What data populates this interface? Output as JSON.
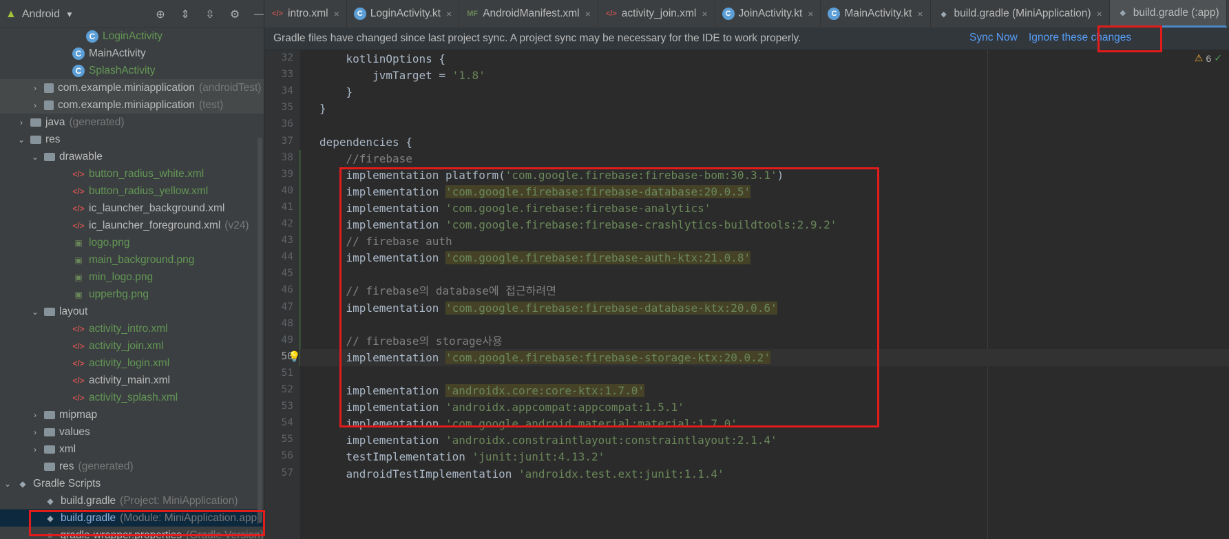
{
  "sidebar": {
    "view_selector": "Android",
    "items": [
      {
        "label": "LoginActivity",
        "icon": "kotlin-class-icon",
        "color": "green",
        "indent": 105
      },
      {
        "label": "MainActivity",
        "icon": "kotlin-class-icon",
        "color": "normal",
        "indent": 85
      },
      {
        "label": "SplashActivity",
        "icon": "kotlin-class-icon",
        "color": "green",
        "indent": 85
      },
      {
        "label": "com.example.miniapplication",
        "suffix": "(androidTest)",
        "icon": "package-icon",
        "arrow": "›",
        "indent": 44,
        "hl": true
      },
      {
        "label": "com.example.miniapplication",
        "suffix": "(test)",
        "icon": "package-icon",
        "arrow": "›",
        "indent": 44,
        "hl": true
      },
      {
        "label": "java",
        "suffix": "(generated)",
        "icon": "folder-icon",
        "arrow": "›",
        "indent": 24
      },
      {
        "label": "res",
        "icon": "folder-icon",
        "arrow": "⌄",
        "indent": 24
      },
      {
        "label": "drawable",
        "icon": "folder-icon",
        "arrow": "⌄",
        "indent": 44
      },
      {
        "label": "button_radius_white.xml",
        "icon": "xml-file-icon",
        "color": "green",
        "indent": 85
      },
      {
        "label": "button_radius_yellow.xml",
        "icon": "xml-file-icon",
        "color": "green",
        "indent": 85
      },
      {
        "label": "ic_launcher_background.xml",
        "icon": "xml-file-icon",
        "indent": 85
      },
      {
        "label": "ic_launcher_foreground.xml",
        "suffix": "(v24)",
        "icon": "xml-file-icon",
        "indent": 85
      },
      {
        "label": "logo.png",
        "icon": "image-file-icon",
        "color": "green",
        "indent": 85
      },
      {
        "label": "main_background.png",
        "icon": "image-file-icon",
        "color": "green",
        "indent": 85
      },
      {
        "label": "min_logo.png",
        "icon": "image-file-icon",
        "color": "green",
        "indent": 85
      },
      {
        "label": "upperbg.png",
        "icon": "image-file-icon",
        "color": "green",
        "indent": 85
      },
      {
        "label": "layout",
        "icon": "folder-icon",
        "arrow": "⌄",
        "indent": 44
      },
      {
        "label": "activity_intro.xml",
        "icon": "xml-file-icon",
        "color": "green",
        "indent": 85
      },
      {
        "label": "activity_join.xml",
        "icon": "xml-file-icon",
        "color": "green",
        "indent": 85
      },
      {
        "label": "activity_login.xml",
        "icon": "xml-file-icon",
        "color": "green",
        "indent": 85
      },
      {
        "label": "activity_main.xml",
        "icon": "xml-file-icon",
        "indent": 85
      },
      {
        "label": "activity_splash.xml",
        "icon": "xml-file-icon",
        "color": "green",
        "indent": 85
      },
      {
        "label": "mipmap",
        "icon": "folder-icon",
        "arrow": "›",
        "indent": 44
      },
      {
        "label": "values",
        "icon": "folder-icon",
        "arrow": "›",
        "indent": 44
      },
      {
        "label": "xml",
        "icon": "folder-icon",
        "arrow": "›",
        "indent": 44
      },
      {
        "label": "res",
        "suffix": "(generated)",
        "icon": "folder-icon",
        "indent": 44
      },
      {
        "label": "Gradle Scripts",
        "icon": "gradle-icon",
        "arrow": "⌄",
        "indent": 4
      },
      {
        "label": "build.gradle",
        "suffix": "(Project: MiniApplication)",
        "icon": "gradle-icon",
        "indent": 44
      },
      {
        "label": "build.gradle",
        "suffix": "(Module: MiniApplication.app)",
        "icon": "gradle-icon",
        "color": "blue",
        "indent": 44,
        "sel": true
      },
      {
        "label": "gradle-wrapper.properties",
        "suffix": "(Gradle Version)",
        "icon": "properties-file-icon",
        "indent": 44
      }
    ]
  },
  "tabs": [
    {
      "label": "intro.xml",
      "icon": "xml"
    },
    {
      "label": "LoginActivity.kt",
      "icon": "kt"
    },
    {
      "label": "AndroidManifest.xml",
      "icon": "mf"
    },
    {
      "label": "activity_join.xml",
      "icon": "xml"
    },
    {
      "label": "JoinActivity.kt",
      "icon": "kt"
    },
    {
      "label": "MainActivity.kt",
      "icon": "kt"
    },
    {
      "label": "build.gradle (MiniApplication)",
      "icon": "gradle"
    },
    {
      "label": "build.gradle (:app)",
      "icon": "gradle",
      "active": true
    }
  ],
  "banner": {
    "message": "Gradle files have changed since last project sync. A project sync may be necessary for the IDE to work properly.",
    "sync_now": "Sync Now",
    "ignore": "Ignore these changes"
  },
  "inspection": {
    "warnings": "6"
  },
  "code": {
    "first_line": 32,
    "current_line": 50,
    "lines": [
      [
        {
          "t": "    kotlinOptions {"
        }
      ],
      [
        {
          "t": "        jvmTarget = "
        },
        {
          "t": "'1.8'",
          "c": "str"
        }
      ],
      [
        {
          "t": "    }"
        }
      ],
      [
        {
          "t": "}"
        }
      ],
      [],
      [
        {
          "t": "dependencies {"
        }
      ],
      [
        {
          "t": "    //firebase",
          "c": "cmt"
        }
      ],
      [
        {
          "t": "    implementation platform("
        },
        {
          "t": "'com.google.firebase:firebase-bom:30.3.1'",
          "c": "str"
        },
        {
          "t": ")"
        }
      ],
      [
        {
          "t": "    implementation "
        },
        {
          "t": "'com.google.firebase:firebase-database:20.0.5'",
          "c": "str hlbg"
        }
      ],
      [
        {
          "t": "    implementation "
        },
        {
          "t": "'com.google.firebase:firebase-analytics'",
          "c": "str"
        }
      ],
      [
        {
          "t": "    implementation "
        },
        {
          "t": "'com.google.firebase:firebase-crashlytics-buildtools:2.9.2'",
          "c": "str"
        }
      ],
      [
        {
          "t": "    // firebase auth",
          "c": "cmt"
        }
      ],
      [
        {
          "t": "    implementation "
        },
        {
          "t": "'com.google.firebase:firebase-auth-ktx:21.0.8'",
          "c": "str hlbg"
        }
      ],
      [],
      [
        {
          "t": "    // firebase의 database에 접근하려면",
          "c": "cmt"
        }
      ],
      [
        {
          "t": "    implementation "
        },
        {
          "t": "'com.google.firebase:firebase-database-ktx:20.0.6'",
          "c": "str hlbg"
        }
      ],
      [],
      [
        {
          "t": "    // firebase의 storage사용",
          "c": "cmt"
        }
      ],
      [
        {
          "t": "    implementation "
        },
        {
          "t": "'com.google.firebase:firebase-storage-ktx:20.0.2'",
          "c": "str hlbg"
        }
      ],
      [],
      [
        {
          "t": "    implementation "
        },
        {
          "t": "'androidx.core:core-ktx:1.7.0'",
          "c": "str hlbg"
        }
      ],
      [
        {
          "t": "    implementation "
        },
        {
          "t": "'androidx.appcompat:appcompat:1.5.1'",
          "c": "str"
        }
      ],
      [
        {
          "t": "    implementation "
        },
        {
          "t": "'com.google.android.material:material:1.7.0'",
          "c": "str"
        }
      ],
      [
        {
          "t": "    implementation "
        },
        {
          "t": "'androidx.constraintlayout:constraintlayout:2.1.4'",
          "c": "str"
        }
      ],
      [
        {
          "t": "    testImplementation "
        },
        {
          "t": "'junit:junit:4.13.2'",
          "c": "str"
        }
      ],
      [
        {
          "t": "    androidTestImplementation "
        },
        {
          "t": "'androidx.test.ext:junit:1.1.4'",
          "c": "str"
        }
      ]
    ]
  }
}
